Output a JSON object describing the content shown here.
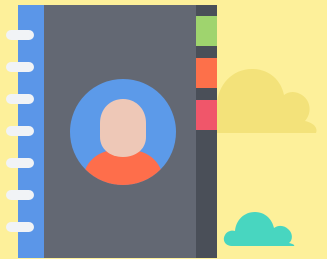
{
  "colors": {
    "background": "#fdf09a",
    "cloud_yellow": "#f3e27a",
    "cloud_teal": "#48d6c0",
    "spine_blue": "#5b96e8",
    "cover_dark": "#636873",
    "binding_dark": "#4a4f58",
    "ring_white": "#f1f3f6",
    "avatar_bg": "#5c9ae9",
    "avatar_face": "#eec8b7",
    "avatar_shirt": "#fe6e4b",
    "tab_green": "#9fd46e",
    "tab_orange": "#fd704a",
    "tab_red": "#f0566a"
  },
  "illustration": {
    "subject": "contact-book",
    "ring_count": 7,
    "tab_count": 3
  }
}
